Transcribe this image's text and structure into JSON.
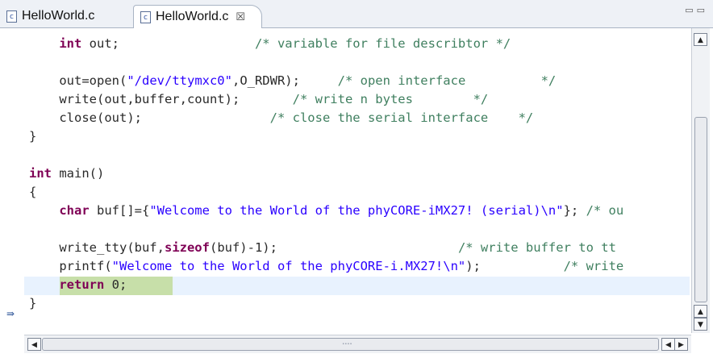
{
  "tabs": [
    {
      "label": "HelloWorld.c",
      "icon": "c-file-icon",
      "active": false
    },
    {
      "label": "HelloWorld.c",
      "icon": "c-file-icon",
      "active": true,
      "close": "☒"
    }
  ],
  "window_controls": "▭ ▭",
  "editor": {
    "language": "C",
    "current_line_index": 13,
    "lines": [
      [
        {
          "t": "    "
        },
        {
          "t": "int",
          "c": "kw"
        },
        {
          "t": " out;                  "
        },
        {
          "t": "/* variable for file describtor */",
          "c": "cmt"
        }
      ],
      [
        {
          "t": ""
        }
      ],
      [
        {
          "t": "    out=open("
        },
        {
          "t": "\"/dev/ttymxc0\"",
          "c": "str"
        },
        {
          "t": ",O_RDWR);     "
        },
        {
          "t": "/* open interface          */",
          "c": "cmt"
        }
      ],
      [
        {
          "t": "    write(out,buffer,count);       "
        },
        {
          "t": "/* write n bytes        */",
          "c": "cmt"
        }
      ],
      [
        {
          "t": "    close(out);                 "
        },
        {
          "t": "/* close the serial interface    */",
          "c": "cmt"
        }
      ],
      [
        {
          "t": "}"
        }
      ],
      [
        {
          "t": ""
        }
      ],
      [
        {
          "t": "int",
          "c": "kw"
        },
        {
          "t": " main()"
        }
      ],
      [
        {
          "t": "{"
        }
      ],
      [
        {
          "t": "    "
        },
        {
          "t": "char",
          "c": "kw"
        },
        {
          "t": " buf[]={"
        },
        {
          "t": "\"Welcome to the World of the phyCORE-iMX27! (serial)\\n\"",
          "c": "str"
        },
        {
          "t": "}; "
        },
        {
          "t": "/* ou",
          "c": "cmt"
        }
      ],
      [
        {
          "t": ""
        }
      ],
      [
        {
          "t": "    write_tty(buf,"
        },
        {
          "t": "sizeof",
          "c": "kw"
        },
        {
          "t": "(buf)-1);                        "
        },
        {
          "t": "/* write buffer to tt",
          "c": "cmt"
        }
      ],
      [
        {
          "t": "    printf("
        },
        {
          "t": "\"Welcome to the World of the phyCORE-i.MX27!\\n\"",
          "c": "str"
        },
        {
          "t": ");           "
        },
        {
          "t": "/* write ",
          "c": "cmt"
        }
      ],
      [
        {
          "t": "    "
        },
        {
          "t": "return",
          "c": "kw"
        },
        {
          "t": " 0;"
        }
      ],
      [
        {
          "t": "}"
        }
      ]
    ]
  },
  "debug_marker_icon": "instruction-pointer-icon",
  "scrollbars": {
    "up_arrow": "▲",
    "down_arrow": "▼",
    "left_arrow": "◀",
    "right_arrow": "▶"
  },
  "colors": {
    "keyword": "#7f0055",
    "string": "#2a00ff",
    "comment": "#3f7f5f",
    "current_line": "#e8f2fe",
    "return_highlight": "#c7dfa9"
  }
}
